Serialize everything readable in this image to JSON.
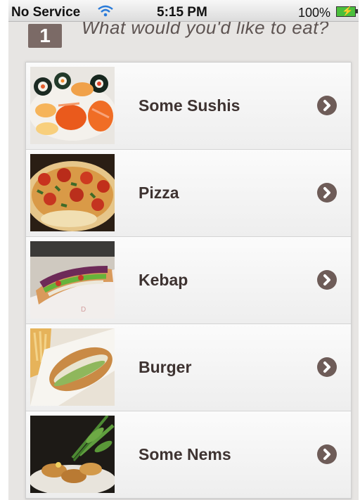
{
  "status_bar": {
    "carrier": "No Service",
    "time": "5:15 PM",
    "battery": "100%"
  },
  "header": {
    "step": "1",
    "question": "What would you'd like to eat?"
  },
  "food_items": [
    {
      "label": "Some Sushis",
      "icon": "sushi-photo"
    },
    {
      "label": "Pizza",
      "icon": "pizza-photo"
    },
    {
      "label": "Kebap",
      "icon": "kebap-photo"
    },
    {
      "label": "Burger",
      "icon": "burger-photo"
    },
    {
      "label": "Some Nems",
      "icon": "nems-photo"
    }
  ],
  "colors": {
    "accent": "#6e5c58",
    "text": "#3e3331",
    "background": "#e7e5e3"
  }
}
